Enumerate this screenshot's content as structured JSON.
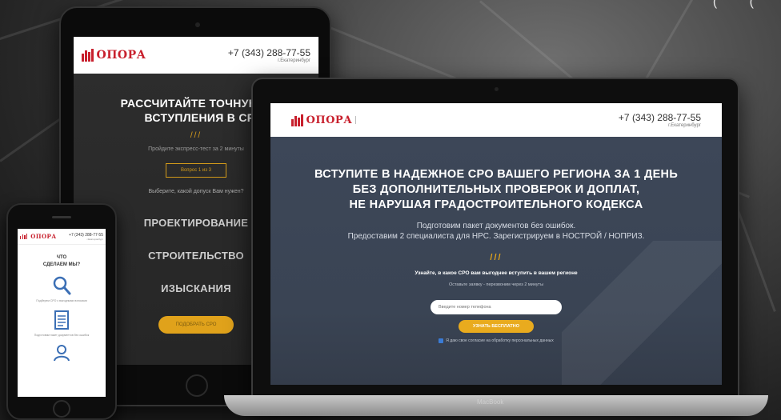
{
  "brand": {
    "name": "ОПОРА",
    "phone": "+7 (343) 288-77-55",
    "city": "г.Екатеринбург"
  },
  "tablet": {
    "heading_line1": "РАССЧИТАЙТЕ ТОЧНУЮ СТО",
    "heading_line2": "ВСТУПЛЕНИЯ В СРО",
    "slashes": "///",
    "subtitle": "Пройдите экспресс-тест за 2 минуты",
    "question_button": "Вопрос 1 из 3",
    "question_text": "Выберите, какой допуск Вам нужен?",
    "services": [
      "ПРОЕКТИРОВАНИЕ",
      "СТРОИТЕЛЬСТВО",
      "ИЗЫСКАНИЯ"
    ],
    "cta": "ПОДОБРАТЬ СРО"
  },
  "phone": {
    "title_line1": "ЧТО",
    "title_line2": "СДЕЛАЕМ МЫ?",
    "items": [
      {
        "icon": "magnifier-icon",
        "caption": "Подберем СРО с выгодными взносами"
      },
      {
        "icon": "document-icon",
        "caption": "Подготовим пакет документов без ошибок"
      },
      {
        "icon": "specialist-icon",
        "caption": ""
      }
    ]
  },
  "laptop": {
    "heading_line1": "ВСТУПИТЕ В НАДЕЖНОЕ СРО ВАШЕГО РЕГИОНА ЗА 1 ДЕНЬ",
    "heading_line2": "БЕЗ ДОПОЛНИТЕЛЬНЫХ ПРОВЕРОК И ДОПЛАТ,",
    "heading_line3": "НЕ НАРУШАЯ ГРАДОСТРОИТЕЛЬНОГО КОДЕКСА",
    "desc_line1": "Подготовим пакет документов без ошибок.",
    "desc_line2": "Предоставим 2 специалиста для НРС. Зарегистрируем в НОСТРОЙ / НОПРИЗ.",
    "slashes": "///",
    "ask": "Узнайте, в какое СРО вам выгоднее вступить в вашем регионе",
    "callback": "Оставьте заявку - перезвоним через 2 минуты",
    "phone_placeholder": "Введите номер телефона",
    "submit": "УЗНАТЬ БЕСПЛАТНО",
    "consent": "Я даю свое согласие на обработку персональных данных",
    "device_label": "MacBook"
  },
  "colors": {
    "brand_red": "#c8202d",
    "accent_gold": "#e0a21b",
    "hero_blue": "#3a4454"
  }
}
